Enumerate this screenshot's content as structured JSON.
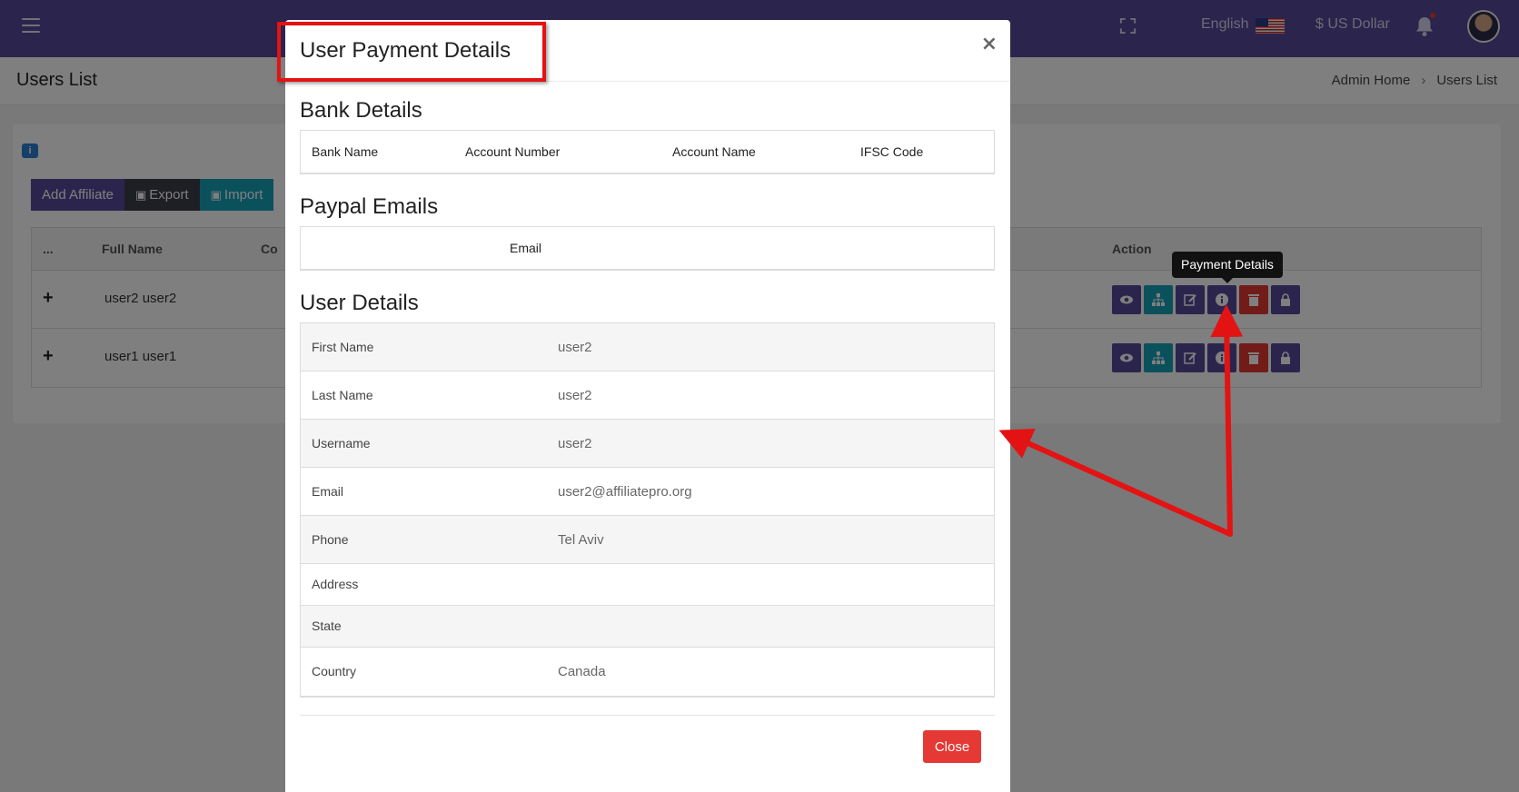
{
  "topbar": {
    "language": "English",
    "currency": "$ US Dollar",
    "icons": [
      "menu-icon",
      "fullscreen-icon",
      "us-flag-icon",
      "bell-icon",
      "avatar"
    ]
  },
  "page": {
    "title": "Users List",
    "breadcrumb": [
      "Admin Home",
      "Users List"
    ],
    "breadcrumb_separator": "›"
  },
  "toolbar": {
    "add_label": "Add Affiliate",
    "export_label": "Export",
    "import_label": "Import"
  },
  "table": {
    "headers": {
      "more": "...",
      "full_name": "Full Name",
      "partial": "Co",
      "action": "Action"
    },
    "rows": [
      {
        "expand": "+",
        "name": "user2 user2"
      },
      {
        "expand": "+",
        "name": "user1 user1"
      }
    ],
    "action_icons": [
      "view-icon",
      "tree-icon",
      "edit-icon",
      "info-icon",
      "delete-icon",
      "lock-icon"
    ]
  },
  "tooltip": "Payment Details",
  "modal": {
    "title": "User Payment Details",
    "close_x": "×",
    "bank": {
      "title": "Bank Details",
      "headers": [
        "Bank Name",
        "Account Number",
        "Account Name",
        "IFSC Code"
      ]
    },
    "paypal": {
      "title": "Paypal Emails",
      "header": "Email"
    },
    "user": {
      "title": "User Details",
      "rows": [
        {
          "label": "First Name",
          "value": "user2"
        },
        {
          "label": "Last Name",
          "value": "user2"
        },
        {
          "label": "Username",
          "value": "user2"
        },
        {
          "label": "Email",
          "value": "user2@affiliatepro.org"
        },
        {
          "label": "Phone",
          "value": "Tel Aviv"
        },
        {
          "label": "Address",
          "value": ""
        },
        {
          "label": "State",
          "value": ""
        },
        {
          "label": "Country",
          "value": "Canada"
        }
      ]
    },
    "close_button": "Close"
  },
  "colors": {
    "brand": "#574a9a",
    "teal": "#17a2b8",
    "danger": "#e53935",
    "annotation": "#e41313"
  }
}
